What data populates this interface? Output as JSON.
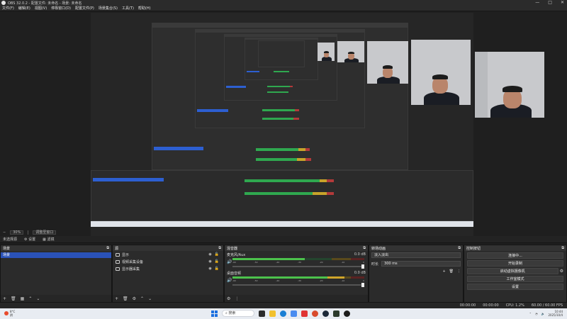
{
  "window": {
    "title": "OBS 32.0.2 - 配置文件: 未命名 - 场景: 未命名",
    "controls": [
      "—",
      "□",
      "✕"
    ]
  },
  "menu": [
    "文件(F)",
    "编辑(E)",
    "视图(V)",
    "停靠窗口(D)",
    "配置文件(P)",
    "场景集合(S)",
    "工具(T)",
    "帮助(H)"
  ],
  "zoom": {
    "value": "30%",
    "mode": "调整至窗口"
  },
  "scene_row": {
    "scene": "未选择源",
    "settings": "设置",
    "filters": "滤镜"
  },
  "scenes": {
    "header": "场景",
    "items": [
      "场景"
    ]
  },
  "sources": {
    "header": "源",
    "items": [
      {
        "name": "显示",
        "icon": "display-icon"
      },
      {
        "name": "视频采集设备",
        "icon": "camera-icon"
      },
      {
        "name": "显示器采集",
        "icon": "monitor-icon"
      }
    ]
  },
  "mixer": {
    "header": "混音器",
    "channels": [
      {
        "name": "麦克风/Aux",
        "db": "0.0 dB",
        "level": 0.6
      },
      {
        "name": "桌面音频",
        "db": "0.0 dB",
        "level": 0.8
      }
    ],
    "ticks": [
      "-60",
      "-55",
      "-50",
      "-45",
      "-40",
      "-35",
      "-30",
      "-25",
      "-20",
      "-15",
      "-10",
      "-5",
      "0"
    ]
  },
  "transitions": {
    "header": "转场动画",
    "selected": "淡入淡出",
    "duration_label": "时长",
    "duration": "300 ms"
  },
  "controls": {
    "header": "控制按钮",
    "buttons": [
      "连接中...",
      "开始录制",
      "启动虚拟摄像机",
      "工作室模式",
      "设置"
    ]
  },
  "status": {
    "time1": "00:00:00",
    "time2": "00:00:00",
    "cpu": "CPU: 1.2%",
    "fps": "60.00 / 60.00 FPS"
  },
  "taskbar": {
    "weather": {
      "temp": "8°C",
      "desc": "阴"
    },
    "search": "搜索",
    "clock": {
      "time": "10:44",
      "date": "2025/10/4"
    }
  },
  "colors": {
    "scene_selected": "#2a52b8",
    "meter_green": "#4cc24c",
    "meter_yellow": "#d0a52a",
    "meter_red": "#c63a3a"
  }
}
